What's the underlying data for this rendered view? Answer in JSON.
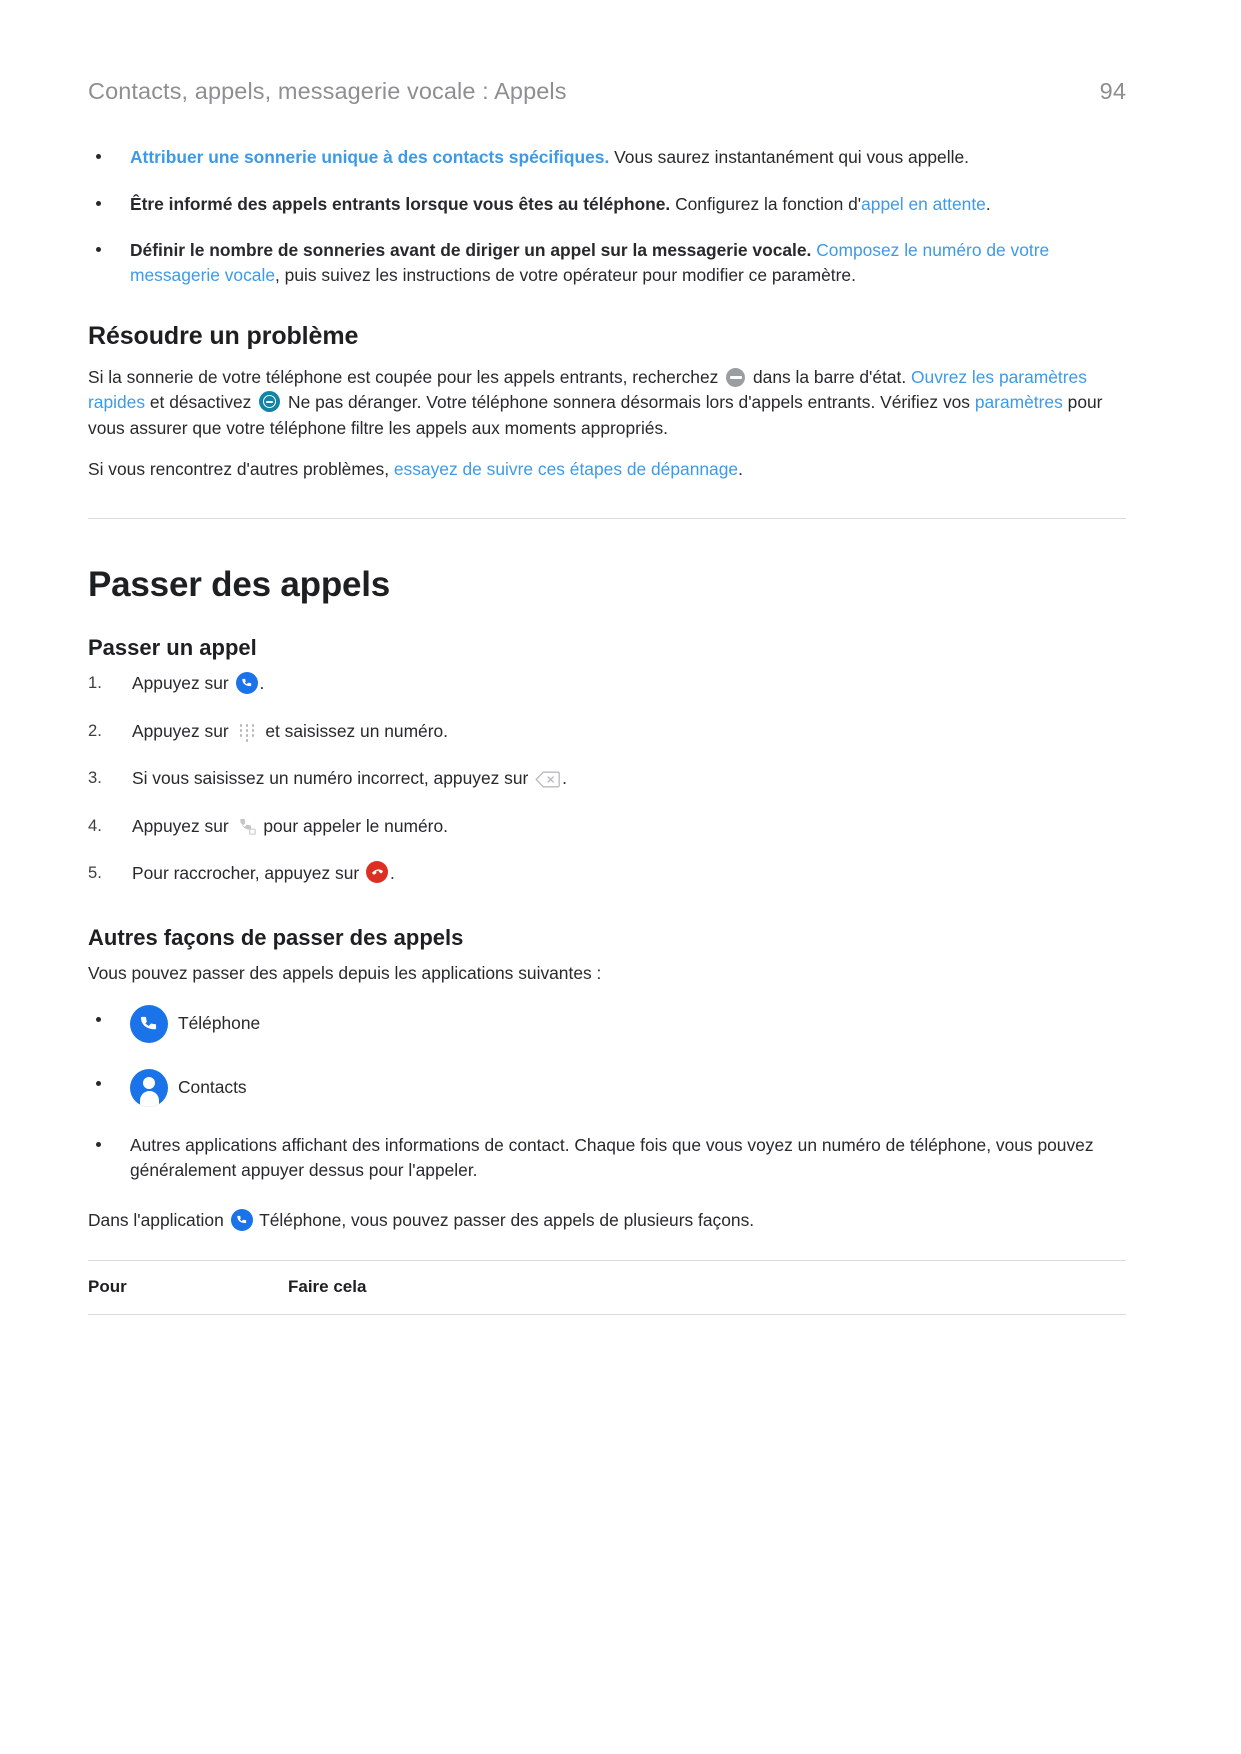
{
  "header": {
    "breadcrumb": "Contacts, appels, messagerie vocale : Appels",
    "page_number": "94"
  },
  "colors": {
    "link": "#3d9ae8",
    "text": "#27292b",
    "header_text": "#8d8f91",
    "rule": "#d9dbdd",
    "phone_app_blue": "#1a73e8",
    "end_call_red": "#dc3023",
    "dnd_grey": "#9b9d9f",
    "dnd_teal": "#1484a6"
  },
  "intro_bullets": [
    {
      "lead": "Attribuer une sonnerie unique à des contacts spécifiques.",
      "lead_is_link": true,
      "rest": " Vous saurez instantanément qui vous appelle."
    },
    {
      "lead": "Être informé des appels entrants lorsque vous êtes au téléphone.",
      "lead_is_link": false,
      "rest_before": " Configurez la fonction d'",
      "link": "appel en attente",
      "rest_after": "."
    },
    {
      "lead": "Définir le nombre de sonneries avant de diriger un appel sur la messagerie vocale.",
      "lead_is_link": false,
      "rest_before": " ",
      "link": "Composez le numéro de votre messagerie vocale",
      "rest_after": ", puis suivez les instructions de votre opérateur pour modifier ce paramètre."
    }
  ],
  "troubleshoot": {
    "heading": "Résoudre un problème",
    "p1_a": "Si la sonnerie de votre téléphone est coupée pour les appels entrants, recherchez ",
    "p1_b": " dans la barre d'état. ",
    "p1_link1": "Ouvrez les paramètres rapides",
    "p1_c": " et désactivez ",
    "p1_d": " Ne pas déranger. Votre téléphone sonnera désormais lors d'appels entrants. Vérifiez vos ",
    "p1_link2": "paramètres",
    "p1_e": " pour vous assurer que votre téléphone filtre les appels aux moments appropriés.",
    "p2_a": "Si vous rencontrez d'autres problèmes, ",
    "p2_link": "essayez de suivre ces étapes de dépannage",
    "p2_b": "."
  },
  "chapter": {
    "title": "Passer des appels"
  },
  "make_call": {
    "heading": "Passer un appel",
    "steps": [
      {
        "before": "Appuyez sur ",
        "icon": "phone-app-icon",
        "after": "."
      },
      {
        "before": "Appuyez sur ",
        "icon": "dialpad-icon",
        "after": " et saisissez un numéro."
      },
      {
        "before": "Si vous saisissez un numéro incorrect, appuyez sur ",
        "icon": "backspace-icon",
        "after": "."
      },
      {
        "before": "Appuyez sur ",
        "icon": "dial-handset-icon",
        "after": " pour appeler le numéro."
      },
      {
        "before": "Pour raccrocher, appuyez sur ",
        "icon": "end-call-icon",
        "after": "."
      }
    ]
  },
  "other_ways": {
    "heading": "Autres façons de passer des appels",
    "intro": "Vous pouvez passer des appels depuis les applications suivantes :",
    "apps": [
      {
        "icon": "phone-app-icon",
        "label": "Téléphone"
      },
      {
        "icon": "contacts-app-icon",
        "label": "Contacts"
      }
    ],
    "last_bullet": "Autres applications affichant des informations de contact. Chaque fois que vous voyez un numéro de téléphone, vous pouvez généralement appuyer dessus pour l'appeler.",
    "closing_a": "Dans l'application ",
    "closing_b": " Téléphone, vous pouvez passer des appels de plusieurs façons."
  },
  "table": {
    "columns": [
      "Pour",
      "Faire cela"
    ]
  }
}
